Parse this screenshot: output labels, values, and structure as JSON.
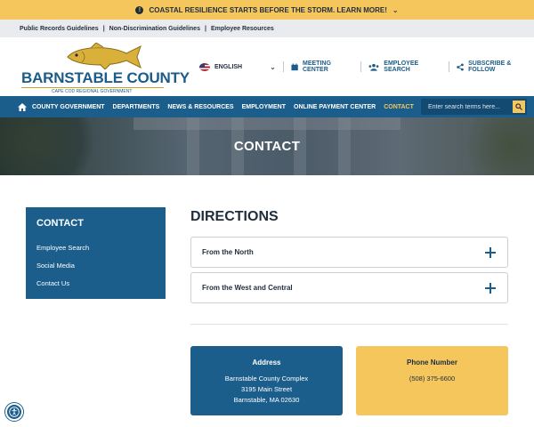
{
  "alert": {
    "text": "COASTAL RESILIENCE STARTS BEFORE THE STORM. LEARN MORE!"
  },
  "utility_links": [
    "Public Records Guidelines",
    "Non-Discrimination Guidelines",
    "Employee Resources"
  ],
  "logo": {
    "name": "BARNSTABLE COUNTY",
    "tagline": "CAPE COD REGIONAL GOVERNMENT"
  },
  "header_links": {
    "language": "ENGLISH",
    "meeting_center": "MEETING CENTER",
    "employee_search": "EMPLOYEE SEARCH",
    "subscribe": "SUBSCRIBE & FOLLOW"
  },
  "nav": {
    "items": [
      "COUNTY GOVERNMENT",
      "DEPARTMENTS",
      "NEWS & RESOURCES",
      "EMPLOYMENT",
      "ONLINE PAYMENT CENTER",
      "CONTACT"
    ],
    "search_placeholder": "Enter search terms here..."
  },
  "hero": {
    "title": "CONTACT"
  },
  "sidebar": {
    "title": "CONTACT",
    "items": [
      "Employee Search",
      "Social Media",
      "Contact Us"
    ]
  },
  "main": {
    "title": "DIRECTIONS",
    "accordions": [
      "From the North",
      "From the West and Central"
    ]
  },
  "cards": {
    "address": {
      "title": "Address",
      "lines": [
        "Barnstable County Complex",
        "3195 Main Street",
        "Barnstable, MA 02630"
      ]
    },
    "phone": {
      "title": "Phone Number",
      "value": "(508) 375-6600"
    }
  },
  "colors": {
    "brand_blue": "#1b5e8c",
    "accent_yellow": "#f5c65c"
  }
}
